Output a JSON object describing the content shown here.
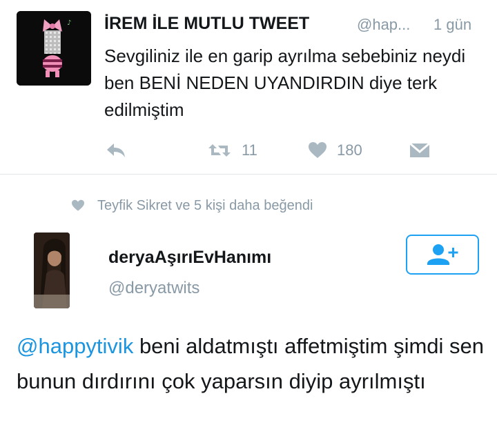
{
  "tweet1": {
    "display_name": "İREM İLE MUTLU TWEET",
    "handle": "@hap...",
    "time": "1 gün",
    "text": "Sevgiliniz ile en garip ayrılma sebebiniz neydi ben BENİ NEDEN UYANDIRDIN diye terk edilmiştim",
    "actions": {
      "reply_icon": "reply-icon",
      "retweet_icon": "retweet-icon",
      "retweet_count": "11",
      "like_icon": "heart-icon",
      "like_count": "180",
      "dm_icon": "envelope-icon"
    }
  },
  "liked_by": {
    "icon": "heart-icon",
    "text": "Teyfik Sikret ve 5 kişi daha beğendi"
  },
  "tweet2": {
    "display_name": "deryaAşırıEvHanımı",
    "handle": "@deryatwits",
    "follow_icon": "follow-user-icon",
    "mention": "@happytivik",
    "text": " beni aldatmıştı affetmiştim şimdi sen bunun dırdırını çok yaparsın diyip ayrılmıştı"
  },
  "colors": {
    "link": "#1b95e0",
    "muted": "#8899a6",
    "text": "#14171a",
    "follow_border": "#1da1f2"
  }
}
